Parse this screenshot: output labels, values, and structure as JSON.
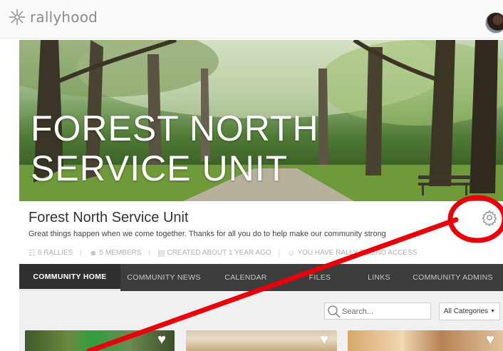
{
  "app": {
    "logo_text": "rallyhood"
  },
  "hero": {
    "title_line1": "FOREST NORTH",
    "title_line2": "SERVICE UNIT"
  },
  "community": {
    "title": "Forest North Service Unit",
    "description": "Great things happen when we come together. Thanks for all you do to help make our community strong",
    "stats": {
      "rallies": "6 RALLIES",
      "members": "5 MEMBERS",
      "created": "CREATED ABOUT 1 YEAR AGO",
      "access": "YOU HAVE RALLY FRIEND ACCESS"
    }
  },
  "nav": {
    "items": [
      {
        "label": "COMMUNITY HOME",
        "active": true
      },
      {
        "label": "COMMUNITY NEWS",
        "active": false
      },
      {
        "label": "CALENDAR",
        "active": false
      },
      {
        "label": "FILES",
        "active": false
      },
      {
        "label": "LINKS",
        "active": false
      },
      {
        "label": "COMMUNITY ADMINS",
        "active": false
      }
    ]
  },
  "filters": {
    "search_placeholder": "Search...",
    "category_selected": "All Categories"
  },
  "colors": {
    "nav_bg": "#3d3d3d",
    "annotation": "#e8000b"
  },
  "icons": [
    "logo-icon",
    "avatar",
    "gear-icon",
    "search-icon",
    "heart-icon",
    "rallies-icon",
    "members-icon",
    "calendar-icon",
    "user-icon"
  ]
}
